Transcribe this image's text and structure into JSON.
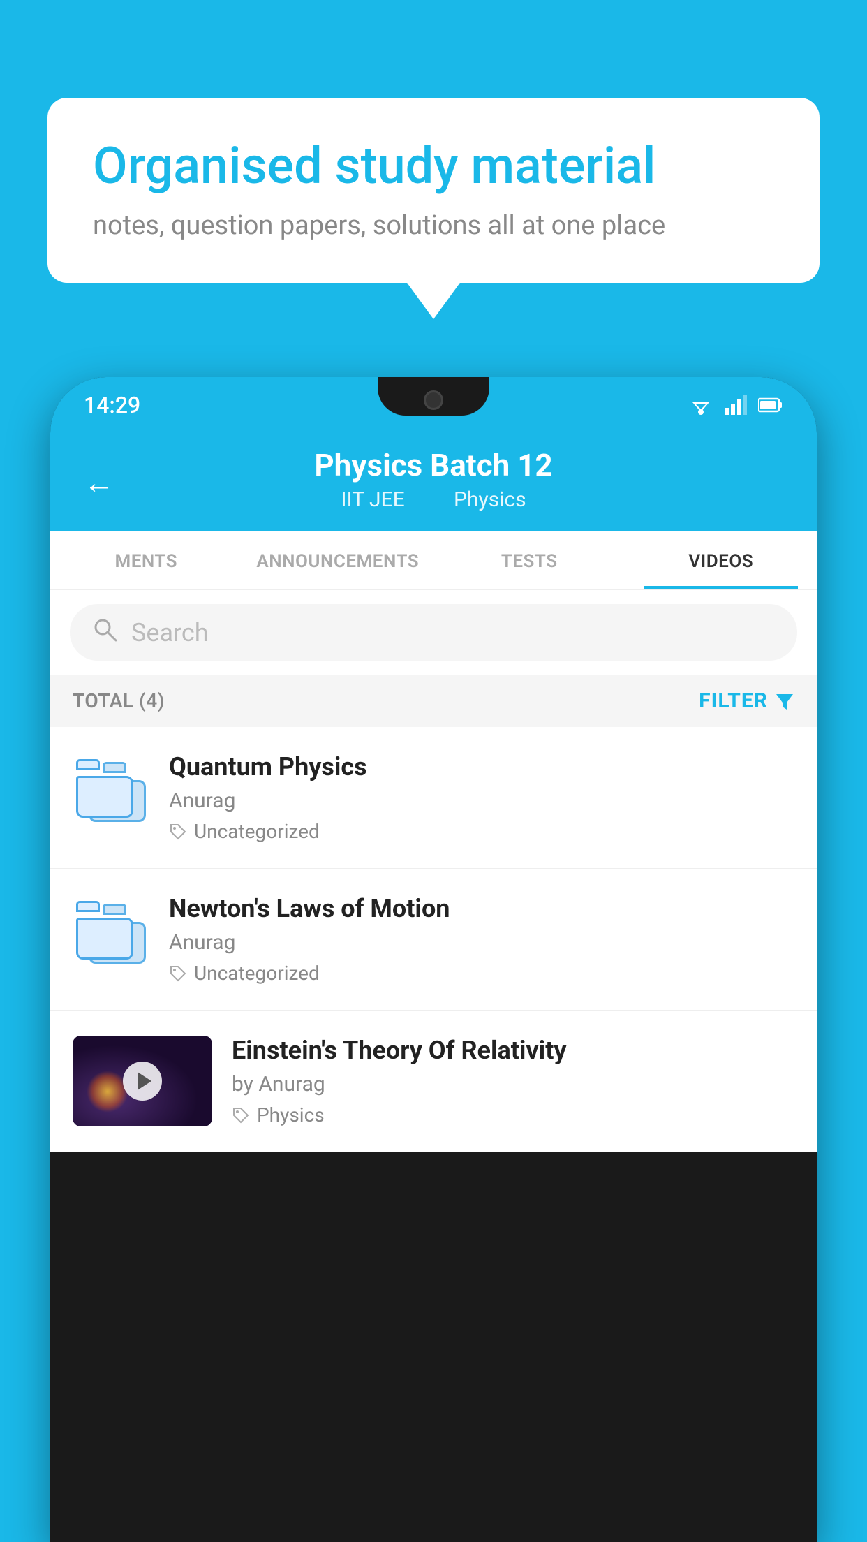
{
  "background": {
    "color": "#1ab8e8"
  },
  "speech_bubble": {
    "title": "Organised study material",
    "subtitle": "notes, question papers, solutions all at one place"
  },
  "phone": {
    "status_bar": {
      "time": "14:29"
    },
    "header": {
      "title": "Physics Batch 12",
      "subtitle_part1": "IIT JEE",
      "subtitle_part2": "Physics",
      "back_label": "←"
    },
    "tabs": [
      {
        "label": "MENTS",
        "active": false
      },
      {
        "label": "ANNOUNCEMENTS",
        "active": false
      },
      {
        "label": "TESTS",
        "active": false
      },
      {
        "label": "VIDEOS",
        "active": true
      }
    ],
    "search": {
      "placeholder": "Search"
    },
    "filter": {
      "total_label": "TOTAL (4)",
      "filter_label": "FILTER"
    },
    "videos": [
      {
        "title": "Quantum Physics",
        "author": "Anurag",
        "tag": "Uncategorized",
        "has_thumbnail": false
      },
      {
        "title": "Newton's Laws of Motion",
        "author": "Anurag",
        "tag": "Uncategorized",
        "has_thumbnail": false
      },
      {
        "title": "Einstein's Theory Of Relativity",
        "author": "by Anurag",
        "tag": "Physics",
        "has_thumbnail": true
      }
    ]
  }
}
